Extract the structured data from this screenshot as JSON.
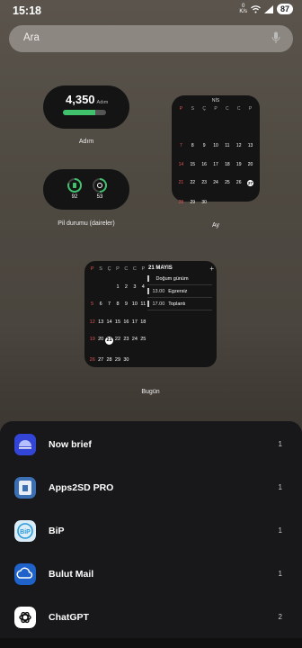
{
  "status": {
    "time": "15:18",
    "speed_value": "0",
    "speed_unit": "K/s",
    "battery": "87"
  },
  "search": {
    "placeholder": "Ara"
  },
  "widgets": {
    "steps": {
      "value": "4,350",
      "unit": "Adım",
      "label": "Adım",
      "progress": 0.75
    },
    "battery": {
      "label": "Pil durumu (daireler)",
      "levels": [
        "92",
        "53"
      ]
    },
    "month": {
      "title": "NİS",
      "label": "Ay",
      "day_headers": [
        "P",
        "S",
        "Ç",
        "P",
        "C",
        "C",
        "P"
      ],
      "weeks": [
        [
          "",
          "",
          "",
          "",
          "",
          "",
          ""
        ],
        [
          "7",
          "8",
          "9",
          "10",
          "11",
          "12",
          "13"
        ],
        [
          "14",
          "15",
          "16",
          "17",
          "18",
          "19",
          "20"
        ],
        [
          "21",
          "22",
          "23",
          "24",
          "25",
          "26",
          "27"
        ],
        [
          "28",
          "29",
          "30",
          "",
          "",
          "",
          ""
        ]
      ]
    },
    "today": {
      "label": "Bugün",
      "date_title": "21 MAYIS",
      "plus": "+",
      "day_headers": [
        "P",
        "S",
        "Ç",
        "P",
        "C",
        "C",
        "P"
      ],
      "weeks": [
        [
          "",
          "",
          "",
          "1",
          "2",
          "3",
          "4"
        ],
        [
          "5",
          "6",
          "7",
          "8",
          "9",
          "10",
          "11"
        ],
        [
          "12",
          "13",
          "14",
          "15",
          "16",
          "17",
          "18"
        ],
        [
          "19",
          "20",
          "21",
          "22",
          "23",
          "24",
          "25"
        ],
        [
          "26",
          "27",
          "28",
          "29",
          "30",
          "",
          ""
        ]
      ],
      "events": [
        {
          "time": "",
          "title": "Doğum günüm"
        },
        {
          "time": "13.00",
          "title": "Egzersiz"
        },
        {
          "time": "17.00",
          "title": "Toplantı"
        }
      ]
    }
  },
  "apps": [
    {
      "name": "Now brief",
      "count": "1",
      "icon": "now-brief-icon"
    },
    {
      "name": "Apps2SD PRO",
      "count": "1",
      "icon": "apps2sd-icon"
    },
    {
      "name": "BiP",
      "count": "1",
      "icon": "bip-icon"
    },
    {
      "name": "Bulut Mail",
      "count": "1",
      "icon": "bulut-mail-icon"
    },
    {
      "name": "ChatGPT",
      "count": "2",
      "icon": "chatgpt-icon"
    }
  ],
  "colors": {
    "steps_fill": "#3fc26b",
    "weekend": "#e05555",
    "sheet": "#18181a"
  }
}
